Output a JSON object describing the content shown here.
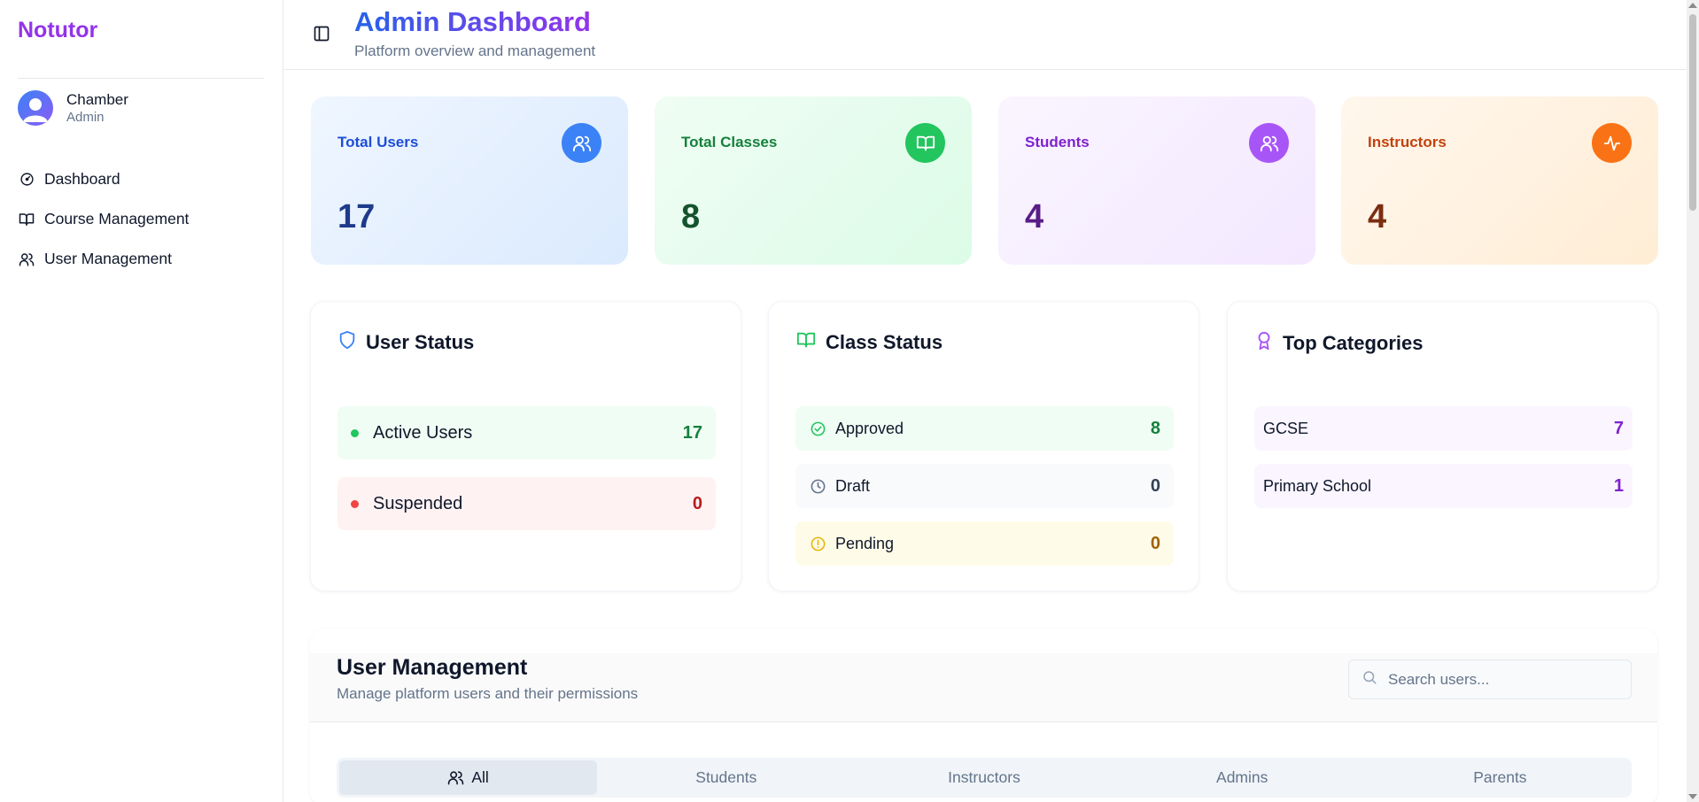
{
  "brand": "Notutor",
  "user": {
    "name": "Chamber",
    "role": "Admin"
  },
  "nav": [
    {
      "label": "Dashboard",
      "icon": "gauge-icon"
    },
    {
      "label": "Course Management",
      "icon": "book-open-icon"
    },
    {
      "label": "User Management",
      "icon": "users-icon"
    }
  ],
  "header": {
    "title": "Admin Dashboard",
    "subtitle": "Platform overview and management"
  },
  "stats": [
    {
      "label": "Total Users",
      "value": "17",
      "icon": "users-icon",
      "color": "#3b82f6"
    },
    {
      "label": "Total Classes",
      "value": "8",
      "icon": "book-open-icon",
      "color": "#22c55e"
    },
    {
      "label": "Students",
      "value": "4",
      "icon": "users-icon",
      "color": "#a855f7"
    },
    {
      "label": "Instructors",
      "value": "4",
      "icon": "activity-icon",
      "color": "#f97316"
    }
  ],
  "user_status": {
    "title": "User Status",
    "rows": [
      {
        "label": "Active Users",
        "value": "17"
      },
      {
        "label": "Suspended",
        "value": "0"
      }
    ]
  },
  "class_status": {
    "title": "Class Status",
    "rows": [
      {
        "label": "Approved",
        "value": "8"
      },
      {
        "label": "Draft",
        "value": "0"
      },
      {
        "label": "Pending",
        "value": "0"
      }
    ]
  },
  "top_categories": {
    "title": "Top Categories",
    "rows": [
      {
        "label": "GCSE",
        "value": "7"
      },
      {
        "label": "Primary School",
        "value": "1"
      }
    ]
  },
  "user_management": {
    "title": "User Management",
    "subtitle": "Manage platform users and their permissions",
    "search_placeholder": "Search users...",
    "tabs": [
      "All",
      "Students",
      "Instructors",
      "Admins",
      "Parents"
    ],
    "active_tab": "All"
  }
}
